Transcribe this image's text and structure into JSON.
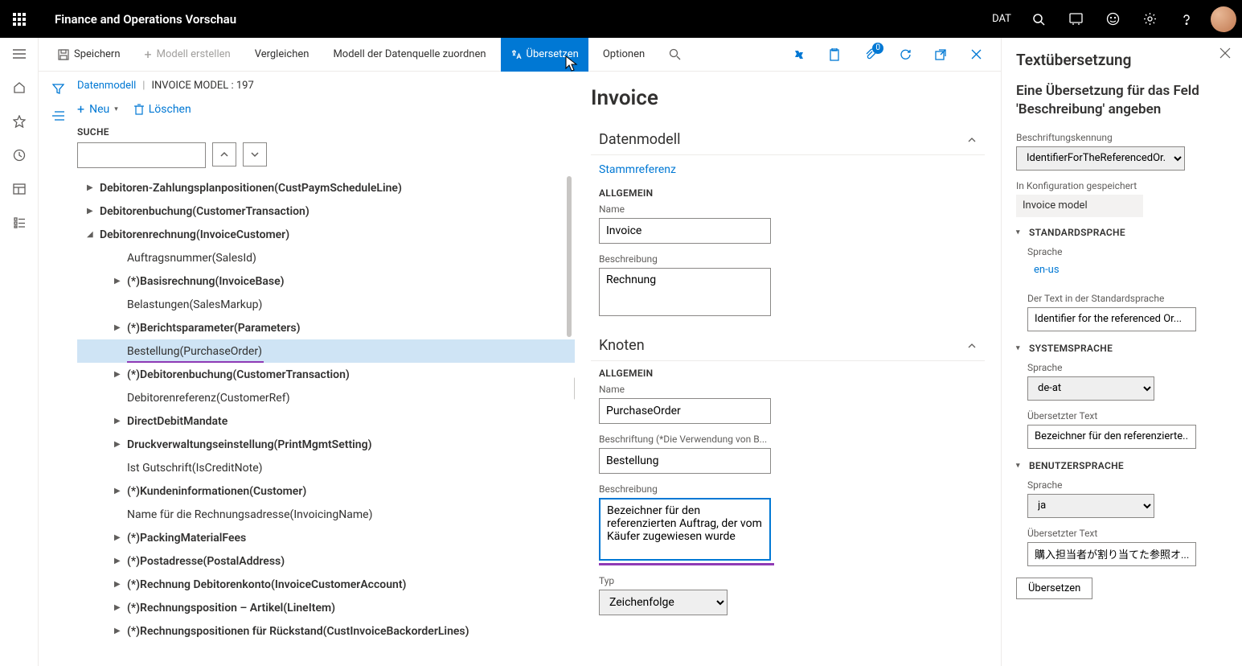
{
  "topbar": {
    "title": "Finance and Operations Vorschau",
    "legal_entity": "DAT"
  },
  "cmdbar": {
    "save": "Speichern",
    "new_model": "Modell erstellen",
    "compare": "Vergleichen",
    "assign_ds": "Modell der Datenquelle zuordnen",
    "translate": "Übersetzen",
    "options": "Optionen",
    "badge": "0"
  },
  "crumbs": {
    "root": "Datenmodell",
    "model": "INVOICE MODEL : 197"
  },
  "actions": {
    "new": "Neu",
    "delete": "Löschen"
  },
  "search_label": "SUCHE",
  "tree": [
    {
      "d": 1,
      "tw": "▶",
      "b": 1,
      "l": "Debitoren-Zahlungsplanpositionen(CustPaymScheduleLine)"
    },
    {
      "d": 1,
      "tw": "▶",
      "b": 1,
      "l": "Debitorenbuchung(CustomerTransaction)"
    },
    {
      "d": 1,
      "tw": "◢",
      "b": 1,
      "l": "Debitorenrechnung(InvoiceCustomer)"
    },
    {
      "d": 2,
      "tw": "",
      "b": 0,
      "l": "Auftragsnummer(SalesId)"
    },
    {
      "d": 2,
      "tw": "▶",
      "b": 1,
      "l": "(*)Basisrechnung(InvoiceBase)"
    },
    {
      "d": 2,
      "tw": "",
      "b": 0,
      "l": "Belastungen(SalesMarkup)"
    },
    {
      "d": 2,
      "tw": "▶",
      "b": 1,
      "l": "(*)Berichtsparameter(Parameters)"
    },
    {
      "d": 2,
      "tw": "",
      "b": 0,
      "l": "Bestellung(PurchaseOrder)",
      "sel": 1,
      "u": 1
    },
    {
      "d": 2,
      "tw": "▶",
      "b": 1,
      "l": "(*)Debitorenbuchung(CustomerTransaction)"
    },
    {
      "d": 2,
      "tw": "",
      "b": 0,
      "l": "Debitorenreferenz(CustomerRef)"
    },
    {
      "d": 2,
      "tw": "▶",
      "b": 1,
      "l": "DirectDebitMandate"
    },
    {
      "d": 2,
      "tw": "▶",
      "b": 1,
      "l": "Druckverwaltungseinstellung(PrintMgmtSetting)"
    },
    {
      "d": 2,
      "tw": "",
      "b": 0,
      "l": "Ist Gutschrift(IsCreditNote)"
    },
    {
      "d": 2,
      "tw": "▶",
      "b": 1,
      "l": "(*)Kundeninformationen(Customer)"
    },
    {
      "d": 2,
      "tw": "",
      "b": 0,
      "l": "Name für die Rechnungsadresse(InvoicingName)"
    },
    {
      "d": 2,
      "tw": "▶",
      "b": 1,
      "l": "(*)PackingMaterialFees"
    },
    {
      "d": 2,
      "tw": "▶",
      "b": 1,
      "l": "(*)Postadresse(PostalAddress)"
    },
    {
      "d": 2,
      "tw": "▶",
      "b": 1,
      "l": "(*)Rechnung Debitorenkonto(InvoiceCustomerAccount)"
    },
    {
      "d": 2,
      "tw": "▶",
      "b": 1,
      "l": "(*)Rechnungsposition – Artikel(LineItem)"
    },
    {
      "d": 2,
      "tw": "▶",
      "b": 1,
      "l": "(*)Rechnungspositionen für Rückstand(CustInvoiceBackorderLines)"
    }
  ],
  "details": {
    "title": "Invoice",
    "s_datamodel": "Datenmodell",
    "root_ref": "Stammreferenz",
    "general": "ALLGEMEIN",
    "name_l": "Name",
    "name_v": "Invoice",
    "desc_l": "Beschreibung",
    "desc_v": "Rechnung",
    "s_node": "Knoten",
    "node_name_v": "PurchaseOrder",
    "caption_l": "Beschriftung (*Die Verwendung von B...",
    "caption_v": "Bestellung",
    "node_desc_v": "Bezeichner für den referenzierten Auftrag, der vom Käufer zugewiesen wurde",
    "type_l": "Typ",
    "type_v": "Zeichenfolge"
  },
  "panel": {
    "title": "Textübersetzung",
    "sub": "Eine Übersetzung für das Feld 'Beschreibung' angeben",
    "label_id_l": "Beschriftungskennung",
    "label_id_v": "IdentifierForTheReferencedOr...",
    "stored_l": "In Konfiguration gespeichert",
    "stored_v": "Invoice model",
    "s_default": "STANDARDSPRACHE",
    "lang_l": "Sprache",
    "default_lang": "en-us",
    "default_text_l": "Der Text in der Standardsprache",
    "default_text_v": "Identifier for the referenced Or...",
    "s_system": "SYSTEMSPRACHE",
    "system_lang": "de-at",
    "trans_text_l": "Übersetzter Text",
    "system_text_v": "Bezeichner für den referenzierte...",
    "s_user": "BENUTZERSPRACHE",
    "user_lang": "ja",
    "user_text_v": "購入担当者が割り当てた参照オ...",
    "btn": "Übersetzen"
  }
}
